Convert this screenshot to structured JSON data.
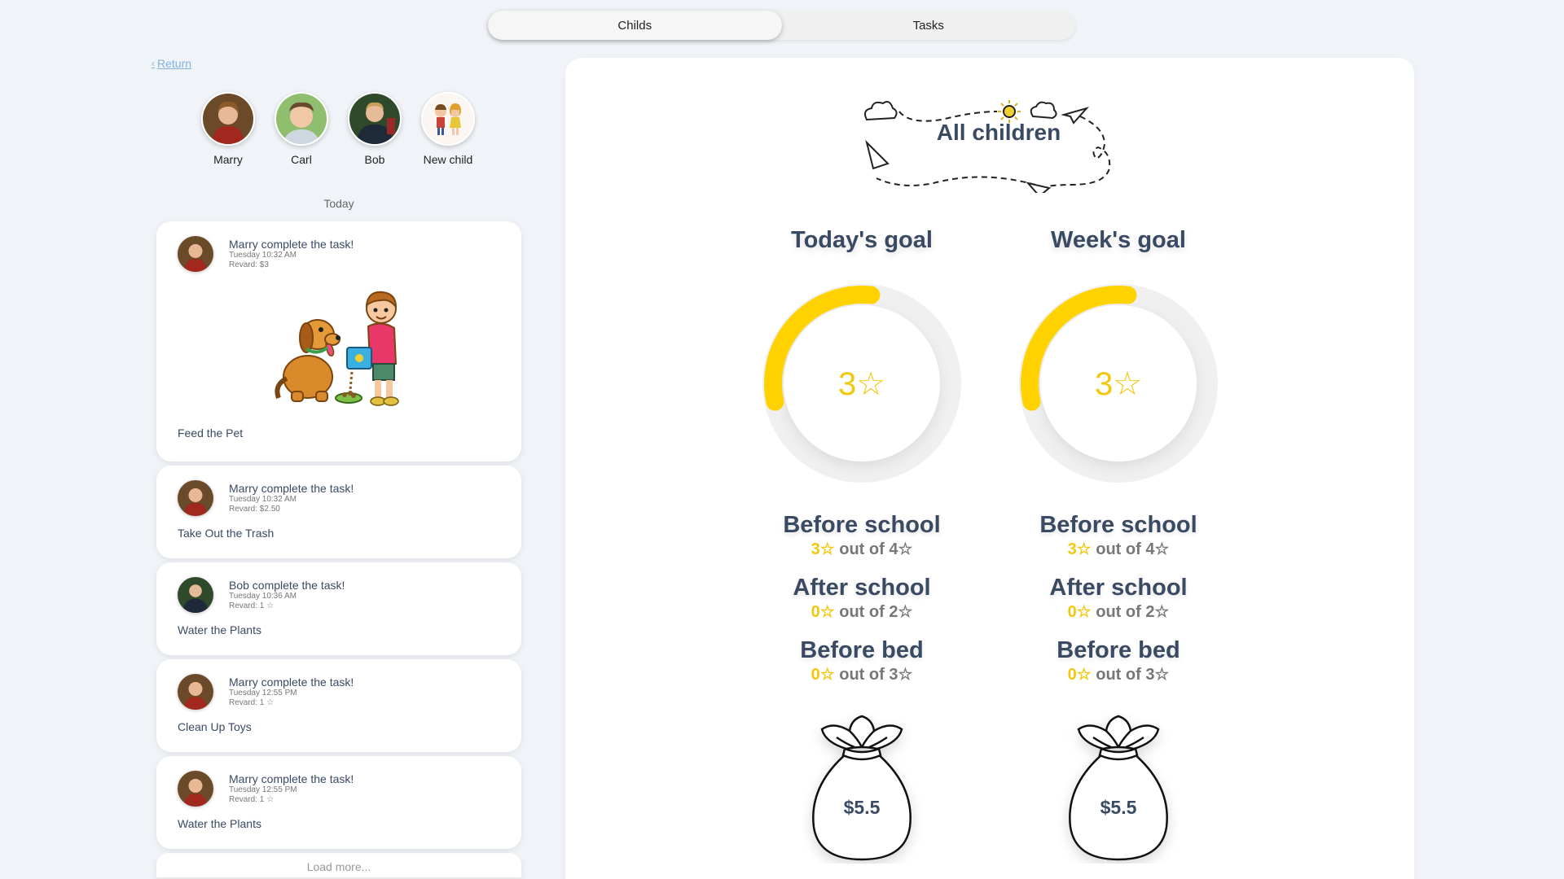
{
  "tabs": [
    {
      "label": "Childs",
      "active": true
    },
    {
      "label": "Tasks",
      "active": false
    }
  ],
  "return_label": "Return",
  "children": [
    {
      "name": "Marry"
    },
    {
      "name": "Carl"
    },
    {
      "name": "Bob"
    },
    {
      "name": "New child"
    }
  ],
  "today_label": "Today",
  "feed": [
    {
      "who": "Marry complete the task!",
      "time": "Tuesday 10:32 AM",
      "reward": "Revard: $3",
      "task": "Feed the Pet"
    },
    {
      "who": "Marry complete the task!",
      "time": "Tuesday 10:32 AM",
      "reward": "Revard: $2.50",
      "task": "Take Out the Trash"
    },
    {
      "who": "Bob complete the task!",
      "time": "Tuesday 10:36 AM",
      "reward": "Revard: 1 ☆",
      "task": "Water the Plants"
    },
    {
      "who": "Marry complete the task!",
      "time": "Tuesday 12:55 PM",
      "reward": "Revard: 1 ☆",
      "task": "Clean Up Toys"
    },
    {
      "who": "Marry complete the task!",
      "time": "Tuesday 12:55 PM",
      "reward": "Revard: 1 ☆",
      "task": "Water the Plants"
    }
  ],
  "load_more": "Load more...",
  "panel": {
    "title": "All children",
    "goals": [
      {
        "title": "Today's goal",
        "value": "3☆",
        "progress": 0.3,
        "sections": [
          {
            "name": "Before school",
            "got": "3☆",
            "rest": " out of 4☆"
          },
          {
            "name": "After school",
            "got": "0☆",
            "rest": " out of 2☆"
          },
          {
            "name": "Before bed",
            "got": "0☆",
            "rest": " out of 3☆"
          }
        ],
        "money": "$5.5"
      },
      {
        "title": "Week's goal",
        "value": "3☆",
        "progress": 0.3,
        "sections": [
          {
            "name": "Before school",
            "got": "3☆",
            "rest": " out of 4☆"
          },
          {
            "name": "After school",
            "got": "0☆",
            "rest": " out of 2☆"
          },
          {
            "name": "Before bed",
            "got": "0☆",
            "rest": " out of 3☆"
          }
        ],
        "money": "$5.5"
      }
    ]
  },
  "colors": {
    "accent": "#f2c80f",
    "text": "#3a4a63",
    "link": "#7fb3de",
    "background": "#f0f3f7"
  }
}
